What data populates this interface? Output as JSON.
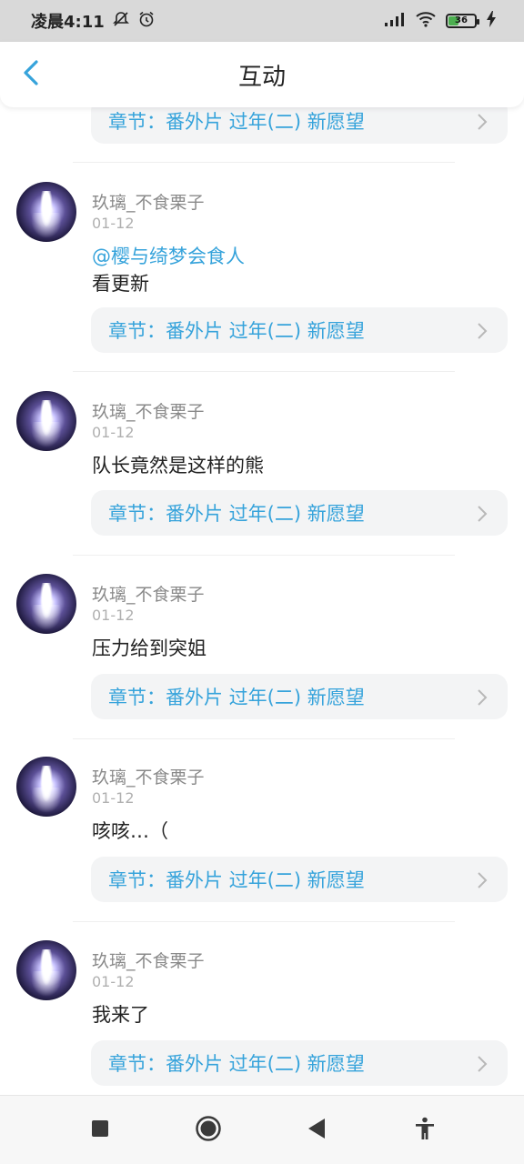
{
  "status_bar": {
    "time": "凌晨4:11",
    "battery": "36"
  },
  "header": {
    "title": "互动"
  },
  "chapter_link_label": "章节：番外片 过年(二) 新愿望",
  "comments": [
    {
      "username": "玖璃_不食栗子",
      "date": "01-12",
      "mention": "@樱与绮梦会食人",
      "text": "看更新"
    },
    {
      "username": "玖璃_不食栗子",
      "date": "01-12",
      "text": "队长竟然是这样的熊"
    },
    {
      "username": "玖璃_不食栗子",
      "date": "01-12",
      "text": "压力给到突姐"
    },
    {
      "username": "玖璃_不食栗子",
      "date": "01-12",
      "text": "咳咳…（"
    },
    {
      "username": "玖璃_不食栗子",
      "date": "01-12",
      "text": "我来了"
    }
  ],
  "colors": {
    "accent": "#36a3db",
    "status_bar_bg": "#d9d9d9",
    "chapter_bg": "#f3f4f5"
  },
  "icons": {
    "back": "chevron-left-icon",
    "chapter_arrow": "chevron-right-icon",
    "nav_recents": "square-icon",
    "nav_home": "circle-icon",
    "nav_back": "triangle-back-icon",
    "accessibility": "accessibility-icon"
  }
}
